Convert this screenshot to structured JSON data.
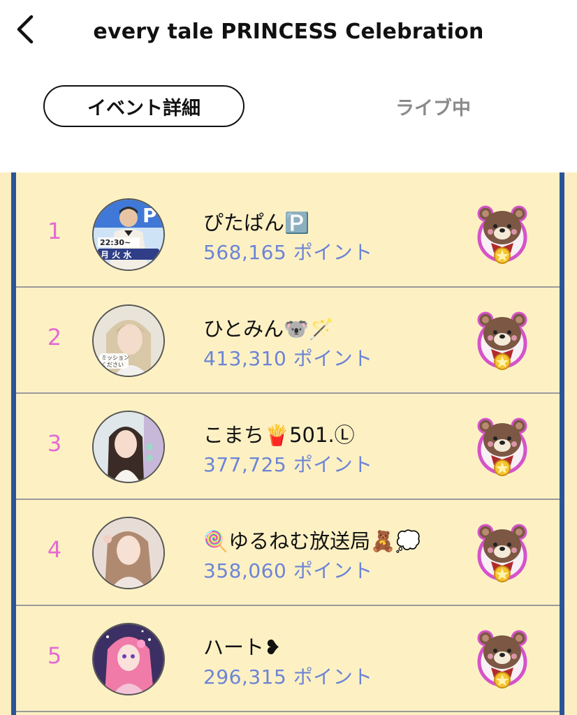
{
  "header": {
    "title": "every tale PRINCESS Celebration"
  },
  "tabs": {
    "event_details": "イベント詳細",
    "live_now": "ライブ中"
  },
  "ranking": [
    {
      "rank": "1",
      "name": "ぴたぱん🅿️",
      "points": "568,165 ポイント"
    },
    {
      "rank": "2",
      "name": "ひとみん🐨🪄",
      "points": "413,310 ポイント"
    },
    {
      "rank": "3",
      "name": "こまち🍟501.Ⓛ",
      "points": "377,725 ポイント"
    },
    {
      "rank": "4",
      "name": "🍭ゆるねむ放送局🧸💭",
      "points": "358,060 ポイント"
    },
    {
      "rank": "5",
      "name": "ハート❥",
      "points": "296,315 ポイント"
    }
  ],
  "colors": {
    "accent_rank": "#e56ad2",
    "points": "#6c84d6",
    "frame": "#2a5597",
    "board_bg": "#fdf1c4"
  },
  "icons": {
    "back": "chevron-left-icon",
    "badge": "bear-medal-icon"
  }
}
